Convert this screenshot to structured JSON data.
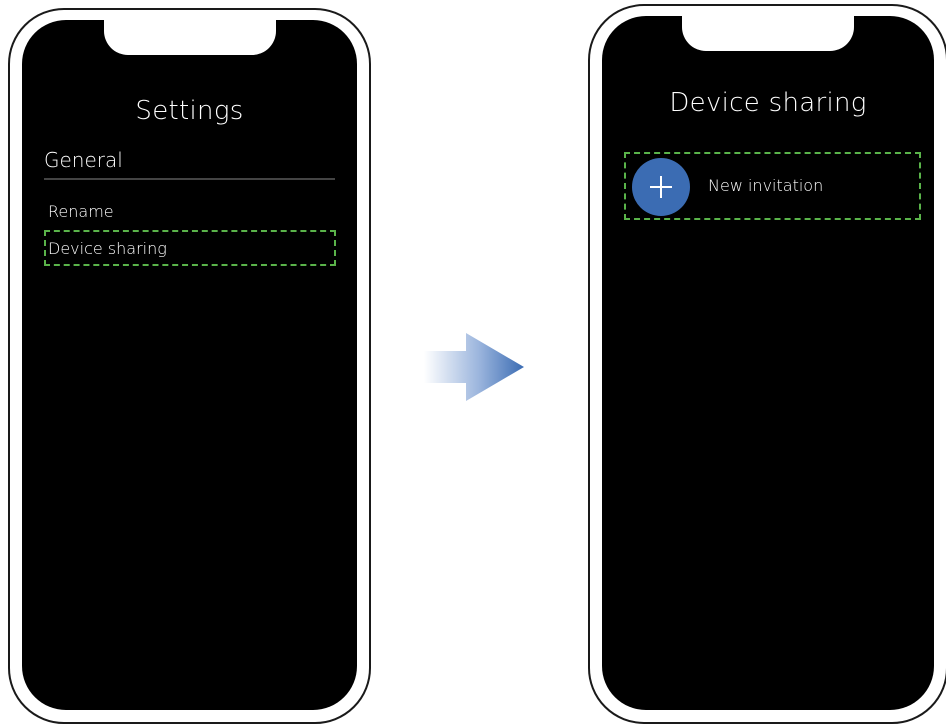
{
  "left_screen": {
    "title": "Settings",
    "section": "General",
    "items": [
      {
        "label": "Rename"
      },
      {
        "label": "Device sharing"
      }
    ]
  },
  "right_screen": {
    "title": "Device sharing",
    "new_invitation_label": "New invitation"
  },
  "colors": {
    "screen_bg": "#000000",
    "highlight": "#5ab34a",
    "plus_button": "#3b6cb3",
    "arrow": "#3b6cb3"
  },
  "icons": {
    "add_button": "plus-icon",
    "transition": "right-arrow-icon"
  }
}
